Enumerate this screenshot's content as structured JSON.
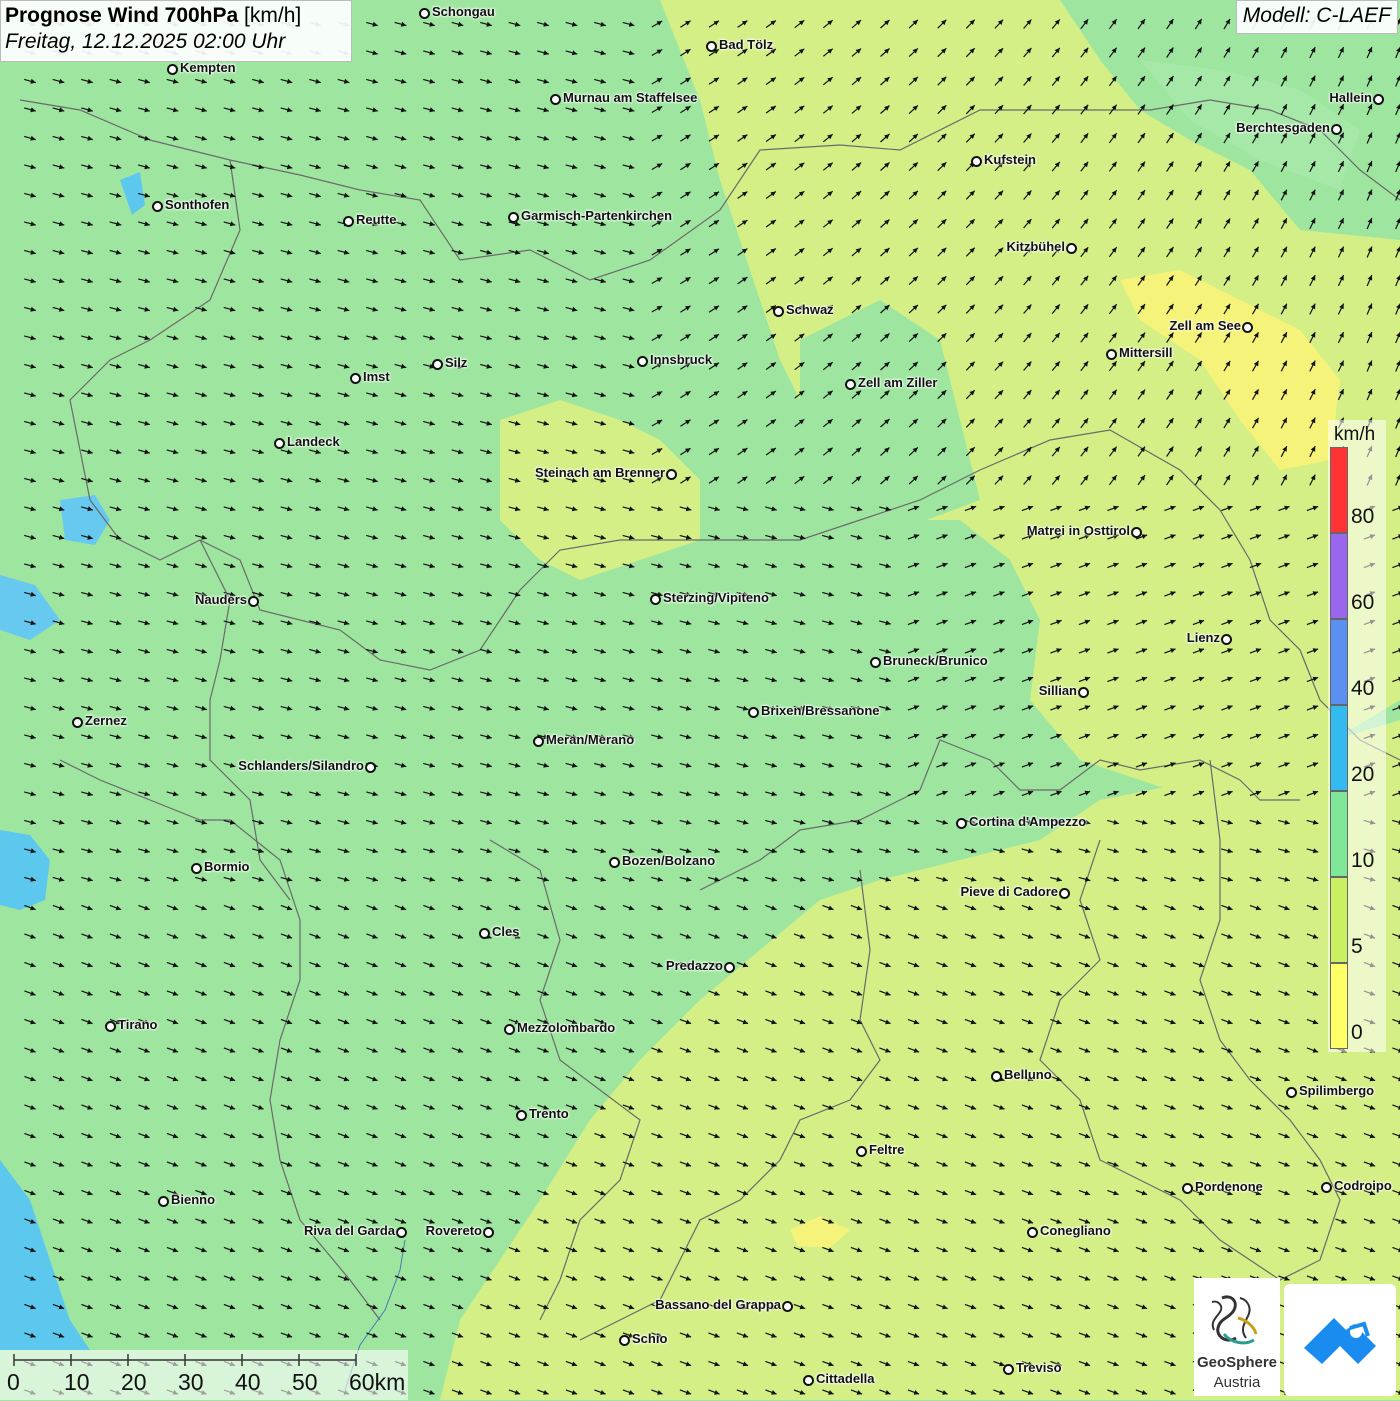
{
  "title": {
    "main": "Prognose Wind 700hPa",
    "unit": "[km/h]",
    "date": "Freitag, 12.12.2025 02:00 Uhr"
  },
  "model": "Modell: C-LAEF",
  "legend": {
    "unit": "km/h",
    "ticks": [
      "80",
      "60",
      "40",
      "20",
      "10",
      "5",
      "0"
    ],
    "colors": [
      "#ff3333",
      "#9966ee",
      "#5b8ff0",
      "#33bbf0",
      "#7ee898",
      "#c8f060",
      "#ffff66"
    ]
  },
  "scale": {
    "labels": [
      "0",
      "10",
      "20",
      "30",
      "40",
      "50",
      "60km"
    ]
  },
  "logos": {
    "geosphere_line1": "GeoSphere",
    "geosphere_line2": "Austria"
  },
  "colors": {
    "green": "#9ee6a0",
    "yellowgreen": "#d4ef86",
    "yellow": "#f5f37a",
    "blue": "#5cc8ee",
    "border": "#666666"
  },
  "cities": [
    {
      "name": "Schongau",
      "dot": [
        424,
        13
      ],
      "side": "right"
    },
    {
      "name": "Bad Tölz",
      "dot": [
        711,
        46
      ],
      "side": "right"
    },
    {
      "name": "Kempten",
      "dot": [
        172,
        69
      ],
      "side": "right"
    },
    {
      "name": "Murnau am Staffelsee",
      "dot": [
        555,
        99
      ],
      "side": "right"
    },
    {
      "name": "Hallein",
      "dot": [
        1378,
        99
      ],
      "side": "left"
    },
    {
      "name": "Berchtesgaden",
      "dot": [
        1336,
        129
      ],
      "side": "left"
    },
    {
      "name": "Kufstein",
      "dot": [
        976,
        161
      ],
      "side": "right"
    },
    {
      "name": "Sonthofen",
      "dot": [
        157,
        206
      ],
      "side": "right"
    },
    {
      "name": "Reutte",
      "dot": [
        348,
        221
      ],
      "side": "right"
    },
    {
      "name": "Garmisch-Partenkirchen",
      "dot": [
        513,
        217
      ],
      "side": "right"
    },
    {
      "name": "Kitzbühel",
      "dot": [
        1071,
        248
      ],
      "side": "left"
    },
    {
      "name": "Schwaz",
      "dot": [
        778,
        311
      ],
      "side": "right"
    },
    {
      "name": "Zell am See",
      "dot": [
        1247,
        327
      ],
      "side": "left"
    },
    {
      "name": "Mittersill",
      "dot": [
        1111,
        354
      ],
      "side": "right"
    },
    {
      "name": "Innsbruck",
      "dot": [
        642,
        361
      ],
      "side": "right"
    },
    {
      "name": "Silz",
      "dot": [
        437,
        364
      ],
      "side": "right"
    },
    {
      "name": "Imst",
      "dot": [
        355,
        378
      ],
      "side": "right"
    },
    {
      "name": "Zell am Ziller",
      "dot": [
        850,
        384
      ],
      "side": "right"
    },
    {
      "name": "Landeck",
      "dot": [
        279,
        443
      ],
      "side": "right"
    },
    {
      "name": "Steinach am Brenner",
      "dot": [
        671,
        474
      ],
      "side": "left"
    },
    {
      "name": "Matrei in Osttirol",
      "dot": [
        1136,
        532
      ],
      "side": "left"
    },
    {
      "name": "Nauders",
      "dot": [
        253,
        601
      ],
      "side": "left"
    },
    {
      "name": "Sterzing/Vipiteno",
      "dot": [
        655,
        599
      ],
      "side": "right"
    },
    {
      "name": "Lienz",
      "dot": [
        1226,
        639
      ],
      "side": "left"
    },
    {
      "name": "Bruneck/Brunico",
      "dot": [
        875,
        662
      ],
      "side": "right"
    },
    {
      "name": "Sillian",
      "dot": [
        1083,
        692
      ],
      "side": "left"
    },
    {
      "name": "Brixen/Bressanone",
      "dot": [
        753,
        712
      ],
      "side": "right"
    },
    {
      "name": "Zernez",
      "dot": [
        77,
        722
      ],
      "side": "right"
    },
    {
      "name": "Meran/Merano",
      "dot": [
        538,
        741
      ],
      "side": "right"
    },
    {
      "name": "Schlanders/Silandro",
      "dot": [
        370,
        767
      ],
      "side": "left"
    },
    {
      "name": "Cortina d'Ampezzo",
      "dot": [
        961,
        823
      ],
      "side": "right"
    },
    {
      "name": "Bozen/Bolzano",
      "dot": [
        614,
        862
      ],
      "side": "right"
    },
    {
      "name": "Bormio",
      "dot": [
        196,
        868
      ],
      "side": "right"
    },
    {
      "name": "Pieve di Cadore",
      "dot": [
        1064,
        893
      ],
      "side": "left"
    },
    {
      "name": "Cles",
      "dot": [
        484,
        933
      ],
      "side": "right"
    },
    {
      "name": "Predazzo",
      "dot": [
        729,
        967
      ],
      "side": "left"
    },
    {
      "name": "Tirano",
      "dot": [
        110,
        1026
      ],
      "side": "right"
    },
    {
      "name": "Mezzolombardo",
      "dot": [
        509,
        1029
      ],
      "side": "right"
    },
    {
      "name": "Belluno",
      "dot": [
        996,
        1076
      ],
      "side": "right"
    },
    {
      "name": "Spilimbergo",
      "dot": [
        1291,
        1092
      ],
      "side": "right"
    },
    {
      "name": "Trento",
      "dot": [
        521,
        1115
      ],
      "side": "right"
    },
    {
      "name": "Feltre",
      "dot": [
        861,
        1151
      ],
      "side": "right"
    },
    {
      "name": "Pordenone",
      "dot": [
        1187,
        1188
      ],
      "side": "right"
    },
    {
      "name": "Codroipo",
      "dot": [
        1326,
        1187
      ],
      "side": "right"
    },
    {
      "name": "Bienno",
      "dot": [
        163,
        1201
      ],
      "side": "right"
    },
    {
      "name": "Riva del Garda",
      "dot": [
        401,
        1232
      ],
      "side": "left"
    },
    {
      "name": "Rovereto",
      "dot": [
        488,
        1232
      ],
      "side": "left"
    },
    {
      "name": "Conegliano",
      "dot": [
        1032,
        1232
      ],
      "side": "right"
    },
    {
      "name": "Bassano del Grappa",
      "dot": [
        787,
        1306
      ],
      "side": "left"
    },
    {
      "name": "Schio",
      "dot": [
        624,
        1340
      ],
      "side": "right"
    },
    {
      "name": "Treviso",
      "dot": [
        1008,
        1369
      ],
      "side": "right"
    },
    {
      "name": "Cittadella",
      "dot": [
        808,
        1380
      ],
      "side": "right"
    }
  ]
}
